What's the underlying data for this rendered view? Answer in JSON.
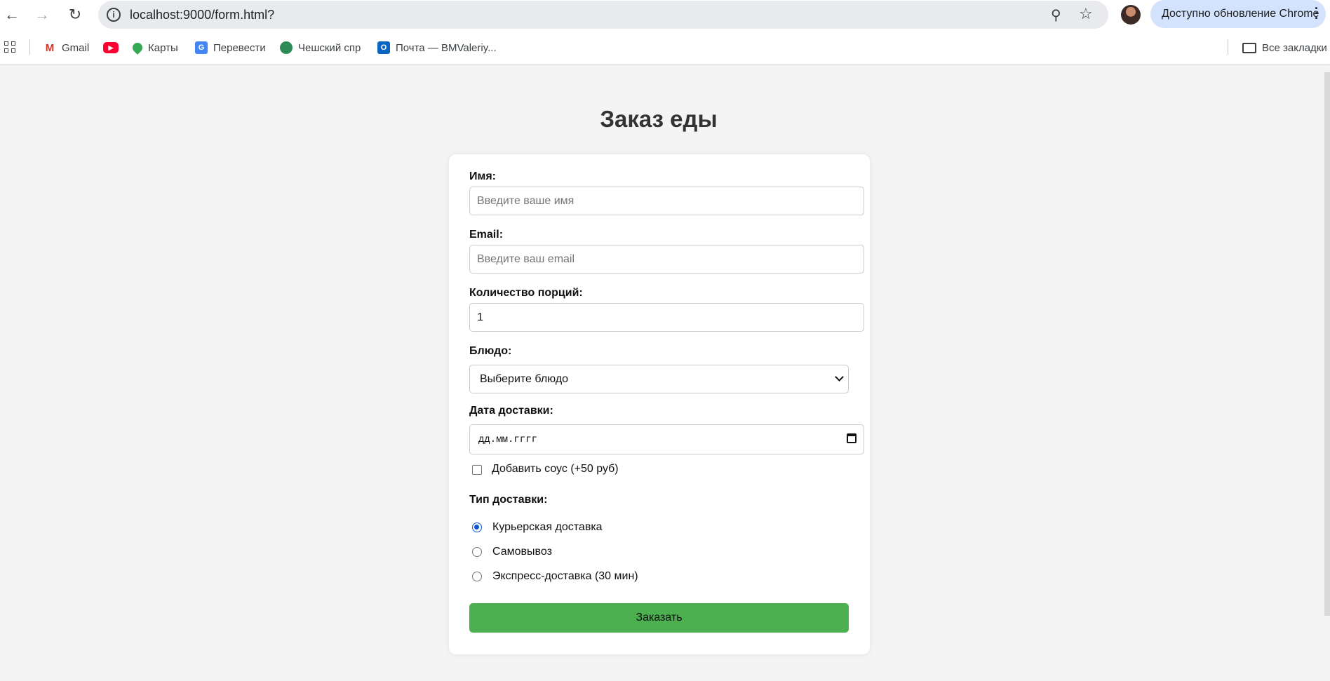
{
  "browser": {
    "url": "localhost:9000/form.html?",
    "update_label": "Доступно обновление Chrome"
  },
  "bookmarks": {
    "items": [
      {
        "label": "Gmail"
      },
      {
        "label": ""
      },
      {
        "label": "Карты"
      },
      {
        "label": "Перевести"
      },
      {
        "label": "Чешский спр"
      },
      {
        "label": "Почта — BMValeriy..."
      }
    ],
    "all_bookmarks": "Все закладки"
  },
  "page": {
    "title": "Заказ еды"
  },
  "form": {
    "name": {
      "label": "Имя:",
      "placeholder": "Введите ваше имя",
      "value": ""
    },
    "email": {
      "label": "Email:",
      "placeholder": "Введите ваш email",
      "value": ""
    },
    "portions": {
      "label": "Количество порций:",
      "value": "1"
    },
    "dish": {
      "label": "Блюдо:",
      "selected": "Выберите блюдо"
    },
    "date": {
      "label": "Дата доставки:",
      "placeholder": "дд.мм.гггг"
    },
    "sauce": {
      "label": "Добавить соус (+50 руб)",
      "checked": false
    },
    "delivery": {
      "label": "Тип доставки:",
      "options": [
        {
          "label": "Курьерская доставка",
          "checked": true
        },
        {
          "label": "Самовывоз",
          "checked": false
        },
        {
          "label": "Экспресс-доставка (30 мин)",
          "checked": false
        }
      ]
    },
    "submit_label": "Заказать"
  },
  "colors": {
    "submit_bg": "#4caf50",
    "page_bg": "#f4f4f4",
    "radio_accent": "#0b57d0"
  }
}
